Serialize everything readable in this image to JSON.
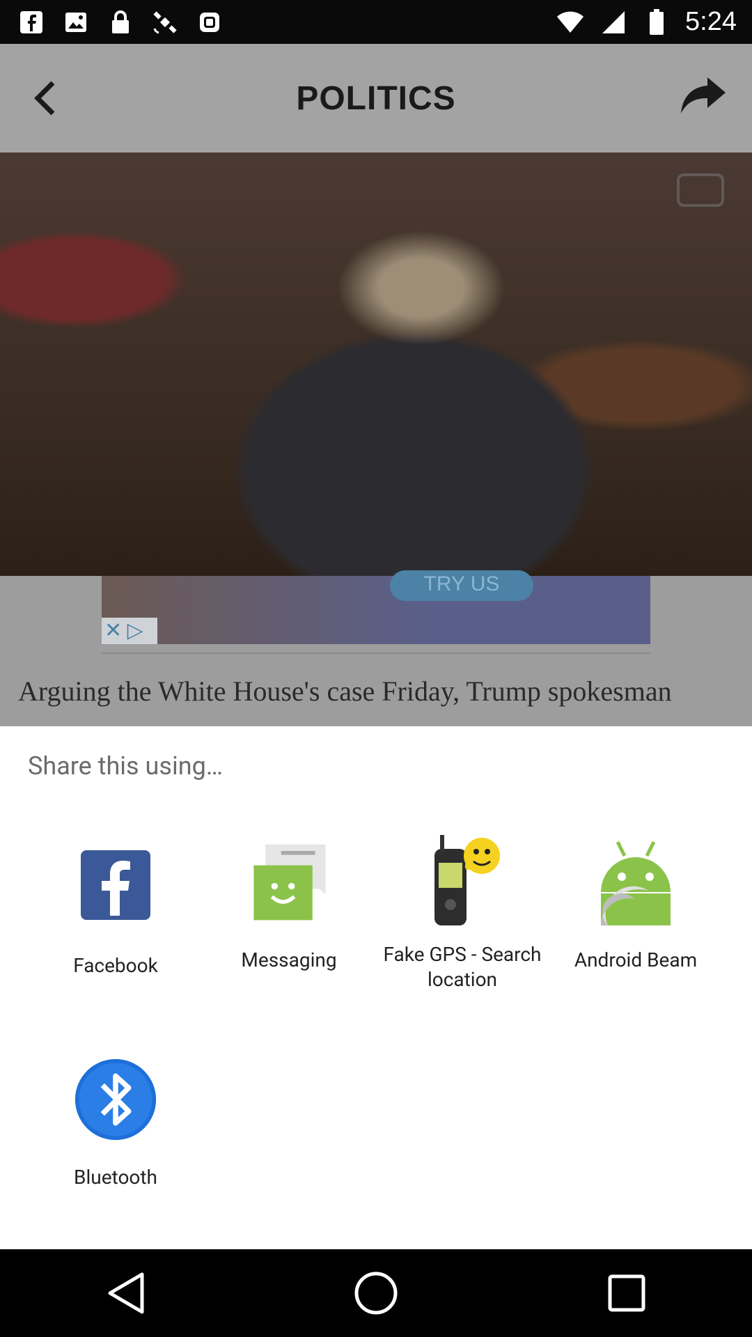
{
  "status_bar": {
    "time": "5:24",
    "icons_left": [
      "facebook-icon",
      "image-icon",
      "lock-icon",
      "satellite-icon",
      "android-icon"
    ],
    "icons_right": [
      "wifi-icon",
      "cellular-signal-icon",
      "battery-icon"
    ]
  },
  "background_app": {
    "title": "POLITICS",
    "ad": {
      "cta": "TRY US",
      "close": "✕ ▷"
    },
    "article_text": "Arguing the White House's case Friday, Trump spokesman"
  },
  "share_sheet": {
    "title": "Share this using…",
    "apps": [
      {
        "label": "Facebook",
        "icon": "facebook-icon"
      },
      {
        "label": "Messaging",
        "icon": "messaging-icon"
      },
      {
        "label": "Fake GPS - Search location",
        "icon": "fake-gps-icon"
      },
      {
        "label": "Android Beam",
        "icon": "android-beam-icon"
      },
      {
        "label": "Bluetooth",
        "icon": "bluetooth-icon"
      }
    ]
  },
  "colors": {
    "facebook": "#3b5998",
    "messaging": "#8bc34a",
    "android": "#8bc34a",
    "bluetooth": "#1e6fd9"
  },
  "nav_bar": [
    "back-icon",
    "home-icon",
    "recents-icon"
  ]
}
